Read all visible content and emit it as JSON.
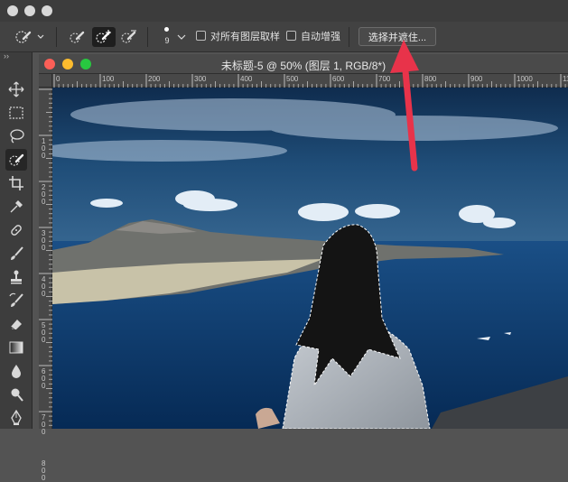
{
  "window": {
    "traffic_lights": [
      "close",
      "minimize",
      "zoom"
    ]
  },
  "options_bar": {
    "brush_size_value": "9",
    "sample_all_layers_label": "对所有图层取样",
    "auto_enhance_label": "自动增强",
    "refine_button_label": "选择并遮住..."
  },
  "tool_panel": {
    "collapse_label": "››",
    "tools": [
      {
        "name": "move-tool-icon"
      },
      {
        "name": "marquee-tool-icon"
      },
      {
        "name": "lasso-tool-icon"
      },
      {
        "name": "quick-selection-tool-icon",
        "active": true
      },
      {
        "name": "crop-tool-icon"
      },
      {
        "name": "eyedropper-tool-icon"
      },
      {
        "name": "healing-brush-tool-icon"
      },
      {
        "name": "brush-tool-icon"
      },
      {
        "name": "clone-stamp-tool-icon"
      },
      {
        "name": "history-brush-tool-icon"
      },
      {
        "name": "eraser-tool-icon"
      },
      {
        "name": "gradient-tool-icon"
      },
      {
        "name": "blur-tool-icon"
      },
      {
        "name": "dodge-tool-icon"
      },
      {
        "name": "pen-tool-icon"
      }
    ]
  },
  "document": {
    "title": "未标题-5 @ 50% (图层 1, RGB/8*)",
    "h_ruler_labels": [
      "0",
      "100",
      "200",
      "300",
      "400",
      "500",
      "600",
      "700",
      "800",
      "900",
      "1000",
      "11"
    ],
    "v_ruler_labels": [
      "1\n0\n0",
      "2\n0\n0",
      "3\n0\n0",
      "4\n0\n0",
      "5\n0\n0",
      "6\n0\n0",
      "7\n0\n0",
      "8\n0\n0"
    ]
  },
  "colors": {
    "annotation_arrow": "#e8334a",
    "sky": "#1c3f63",
    "sea": "#0d3e72"
  }
}
